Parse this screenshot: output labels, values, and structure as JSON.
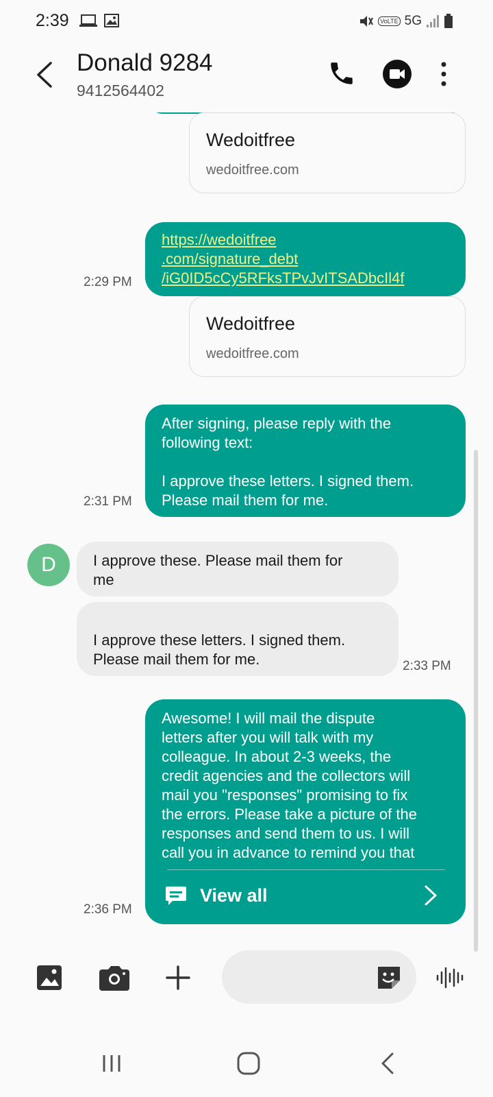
{
  "status_bar": {
    "time": "2:39",
    "network": "5G",
    "volte": "VoLTE",
    "left_icons": [
      "laptop-icon",
      "image-icon"
    ],
    "right_icons": [
      "mute-icon",
      "volte-icon",
      "signal-icon",
      "battery-icon"
    ]
  },
  "header": {
    "contact_name": "Donald 9284",
    "contact_number": "9412564402",
    "icons": [
      "back-icon",
      "phone-icon",
      "video-call-icon",
      "more-vert-icon"
    ]
  },
  "messages": [
    {
      "direction": "outgoing",
      "preview": {
        "title": "Wedoitfree",
        "domain": "wedoitfree.com"
      }
    },
    {
      "direction": "outgoing",
      "time": "2:29 PM",
      "link_lines": [
        "https://wedoitfree",
        ".com/signature_debt",
        "/iG0ID5cCy5RFksTPvJvITSADbcIl4f"
      ],
      "preview": {
        "title": "Wedoitfree",
        "domain": "wedoitfree.com"
      }
    },
    {
      "direction": "outgoing",
      "time": "2:31 PM",
      "lines": [
        "After signing, please reply with the",
        "following text:",
        "",
        "I approve these letters. I signed them.",
        "Please mail them for me."
      ]
    },
    {
      "direction": "incoming",
      "avatar_letter": "D",
      "lines": [
        "I approve these. Please mail them for",
        "me"
      ]
    },
    {
      "direction": "incoming",
      "time": "2:33 PM",
      "lines": [
        "",
        "I approve these letters. I signed them.",
        "Please mail them for me."
      ]
    },
    {
      "direction": "outgoing",
      "time": "2:36 PM",
      "lines": [
        "Awesome! I will mail the dispute",
        "letters after you will talk with my",
        "colleague. In about 2-3 weeks, the",
        "credit agencies and the collectors will",
        "mail you \"responses\" promising to fix",
        "the errors. Please take a picture of the",
        "responses and send them to us. I will",
        "call you in advance to remind you that"
      ],
      "view_all_label": "View all"
    }
  ],
  "composer": {
    "placeholder": "",
    "icons": [
      "gallery-icon",
      "camera-icon",
      "plus-icon",
      "sticker-icon",
      "voice-wave-icon"
    ]
  },
  "nav_bar": {
    "icons": [
      "recents-icon",
      "home-icon",
      "back-icon"
    ]
  },
  "colors": {
    "outgoing_bubble": "#009e8e",
    "incoming_bubble": "#ececec",
    "link_text": "#f0f08a",
    "avatar": "#66c08a",
    "background": "#fafafa"
  }
}
